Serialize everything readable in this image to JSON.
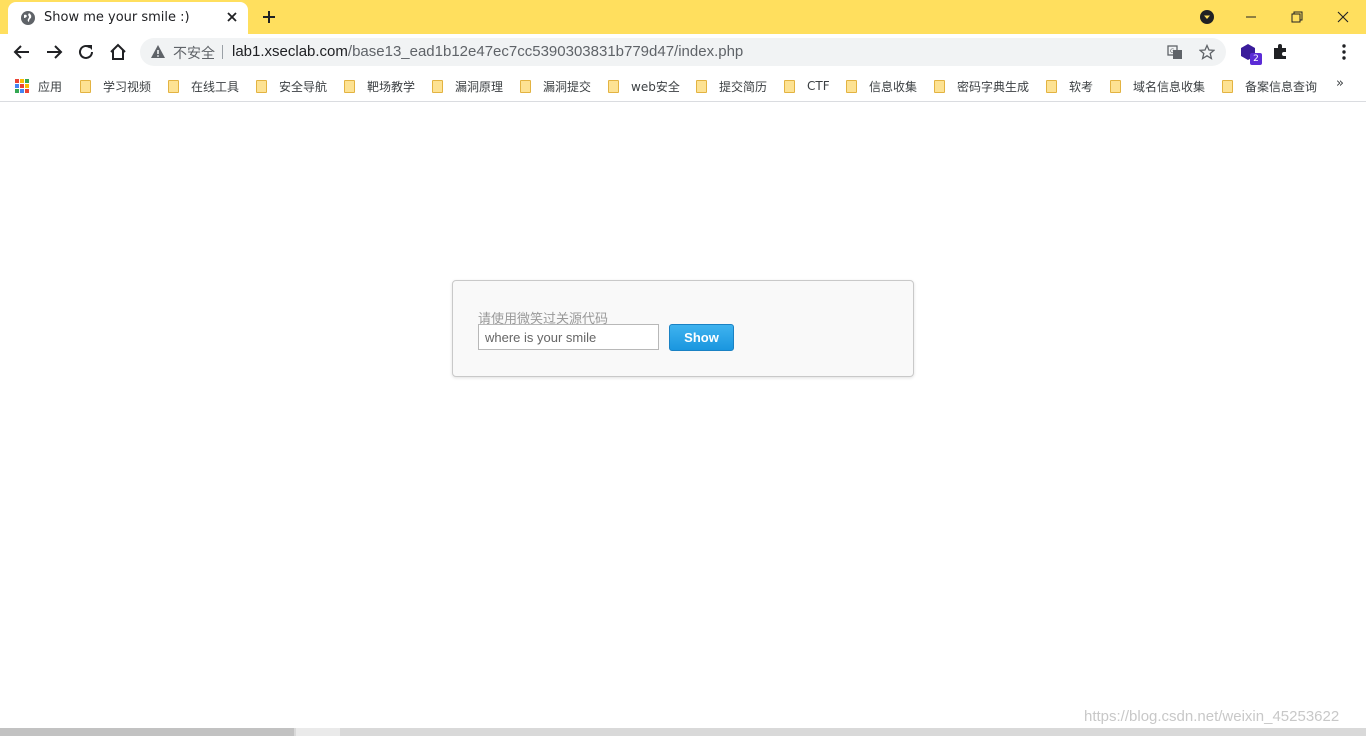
{
  "browser": {
    "tab_title": "Show me your smile :)",
    "insecure_label": "不安全",
    "url_host": "lab1.xseclab.com",
    "url_path": "/base13_ead1b12e47ec7cc5390303831b779d47/index.php",
    "extension_badge": "2"
  },
  "bookmarks": {
    "apps_label": "应用",
    "items": [
      {
        "label": "学习视频"
      },
      {
        "label": "在线工具"
      },
      {
        "label": "安全导航"
      },
      {
        "label": "靶场教学"
      },
      {
        "label": "漏洞原理"
      },
      {
        "label": "漏洞提交"
      },
      {
        "label": "web安全"
      },
      {
        "label": "提交简历"
      },
      {
        "label": "CTF"
      },
      {
        "label": "信息收集"
      },
      {
        "label": "密码字典生成"
      },
      {
        "label": "软考"
      },
      {
        "label": "域名信息收集"
      },
      {
        "label": "备案信息查询"
      }
    ],
    "more_label": "»"
  },
  "page": {
    "prompt": "请使用微笑过关源代码",
    "input_placeholder": "where is your smile",
    "button_label": "Show"
  },
  "watermark": "https://blog.csdn.net/weixin_45253622",
  "colors": {
    "tabstrip": "#ffdf5e",
    "button": "#1a96df"
  }
}
